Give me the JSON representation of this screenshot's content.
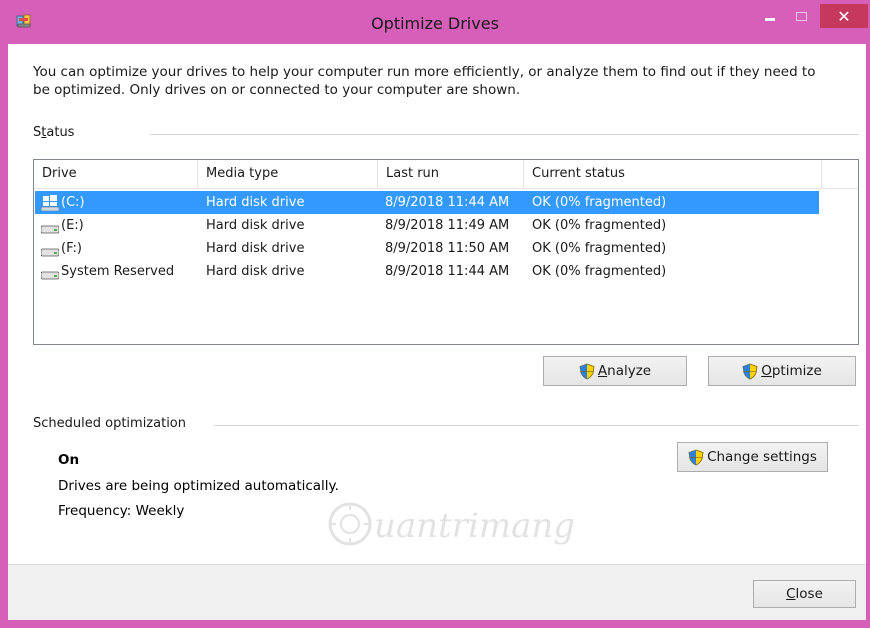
{
  "window": {
    "title": "Optimize Drives",
    "close_glyph": "✕",
    "accent": "#d65fb9",
    "close_color": "#c7385f"
  },
  "intro": {
    "text": "You can optimize your drives to help your computer run more efficiently, or analyze them to find out if they need to be optimized. Only drives on or connected to your computer are shown."
  },
  "status": {
    "label_prefix": "S",
    "label_accel": "t",
    "label_rest": "atus",
    "columns": [
      "Drive",
      "Media type",
      "Last run",
      "Current status"
    ],
    "drives": [
      {
        "drive": "(C:)",
        "icon": "windows-drive-icon",
        "media": "Hard disk drive",
        "last_run": "8/9/2018 11:44 AM",
        "current_status": "OK (0% fragmented)",
        "selected": true
      },
      {
        "drive": "(E:)",
        "icon": "hard-drive-icon",
        "media": "Hard disk drive",
        "last_run": "8/9/2018 11:49 AM",
        "current_status": "OK (0% fragmented)",
        "selected": false
      },
      {
        "drive": "(F:)",
        "icon": "hard-drive-icon",
        "media": "Hard disk drive",
        "last_run": "8/9/2018 11:50 AM",
        "current_status": "OK (0% fragmented)",
        "selected": false
      },
      {
        "drive": "System Reserved",
        "icon": "hard-drive-icon",
        "media": "Hard disk drive",
        "last_run": "8/9/2018 11:44 AM",
        "current_status": "OK (0% fragmented)",
        "selected": false
      }
    ],
    "selection_color": "#3399ff"
  },
  "buttons": {
    "analyze_accel": "A",
    "analyze_rest": "nalyze",
    "optimize_accel": "O",
    "optimize_rest": "ptimize",
    "change_accel": "",
    "change_label": "Change settings",
    "close_accel": "C",
    "close_rest": "lose"
  },
  "scheduled": {
    "label": "Scheduled optimization",
    "state": "On",
    "description": "Drives are being optimized automatically.",
    "frequency": "Frequency: Weekly"
  },
  "watermark": {
    "text": "uantrimang"
  }
}
